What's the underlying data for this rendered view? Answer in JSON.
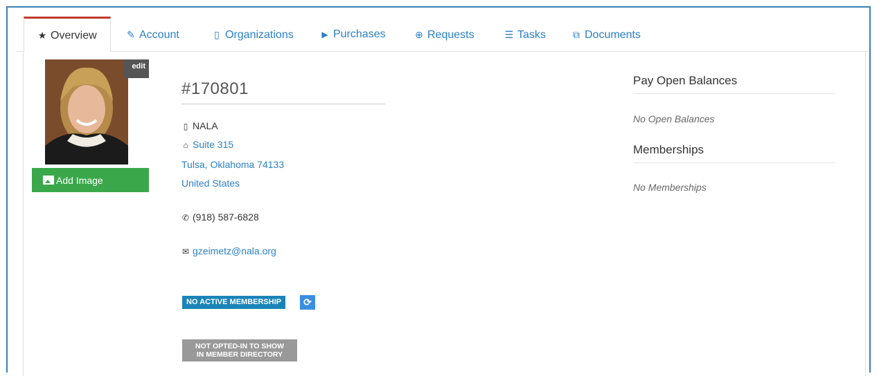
{
  "tabs": [
    {
      "label": "Overview",
      "icon": "star-icon",
      "glyph": "★"
    },
    {
      "label": "Account",
      "icon": "edit-icon",
      "glyph": "✎"
    },
    {
      "label": "Organizations",
      "icon": "building-icon",
      "glyph": "▯"
    },
    {
      "label": "Purchases",
      "icon": "cart-icon",
      "glyph": "🛒"
    },
    {
      "label": "Requests",
      "icon": "lifebuoy-icon",
      "glyph": "⊕"
    },
    {
      "label": "Tasks",
      "icon": "tasks-icon",
      "glyph": "☰"
    },
    {
      "label": "Documents",
      "icon": "files-icon",
      "glyph": "⧉"
    }
  ],
  "profile": {
    "edit_label": "edit",
    "add_image_label": "Add Image",
    "member_id": "#170801",
    "organization": "NALA",
    "address_line1": "Suite 315",
    "address_line2": "Tulsa, Oklahoma 74133",
    "country": "United States",
    "phone": "(918) 587-6828",
    "email": "gzeimetz@nala.org",
    "membership_badge": "NO ACTIVE MEMBERSHIP",
    "directory_badge_line1": "NOT OPTED-IN TO SHOW",
    "directory_badge_line2": "IN MEMBER DIRECTORY"
  },
  "sidebar": {
    "balances_heading": "Pay Open Balances",
    "balances_empty": "No Open Balances",
    "memberships_heading": "Memberships",
    "memberships_empty": "No Memberships"
  },
  "colors": {
    "accent": "#2a7fc7",
    "active_tab_border": "#c0392b",
    "add_image_bg": "#3aa84a",
    "membership_badge_bg": "#1a84b8",
    "directory_badge_bg": "#999999"
  }
}
